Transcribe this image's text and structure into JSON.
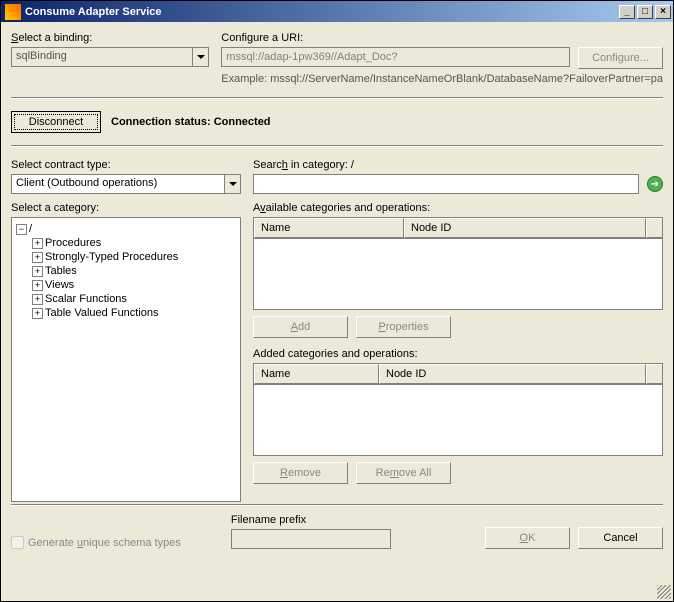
{
  "window": {
    "title": "Consume Adapter Service"
  },
  "binding": {
    "label": "Select a binding:",
    "value": "sqlBinding"
  },
  "uri": {
    "label": "Configure a URI:",
    "value": "mssql://adap-1pw369//Adapt_Doc?",
    "configure_btn": "Configure...",
    "example": "Example: mssql://ServerName/InstanceNameOrBlank/DatabaseName?FailoverPartner=pa"
  },
  "conn": {
    "disconnect_btn": "Disconnect",
    "status_label": "Connection status:",
    "status_value": "Connected"
  },
  "contract": {
    "label": "Select contract type:",
    "value": "Client (Outbound operations)"
  },
  "search": {
    "label": "Search in category: /",
    "value": ""
  },
  "category": {
    "label": "Select a category:",
    "tree": {
      "root": "/",
      "items": [
        "Procedures",
        "Strongly-Typed Procedures",
        "Tables",
        "Views",
        "Scalar Functions",
        "Table Valued Functions"
      ]
    }
  },
  "available": {
    "label": "Available categories and operations:",
    "col_name": "Name",
    "col_node": "Node ID",
    "add_btn": "Add",
    "props_btn": "Properties"
  },
  "added": {
    "label": "Added categories and operations:",
    "col_name": "Name",
    "col_node": "Node ID",
    "remove_btn": "Remove",
    "removeall_btn": "Remove All"
  },
  "bottom": {
    "gen_schema": "Generate unique schema types",
    "filename_label": "Filename prefix",
    "filename_value": "",
    "ok": "OK",
    "cancel": "Cancel"
  }
}
